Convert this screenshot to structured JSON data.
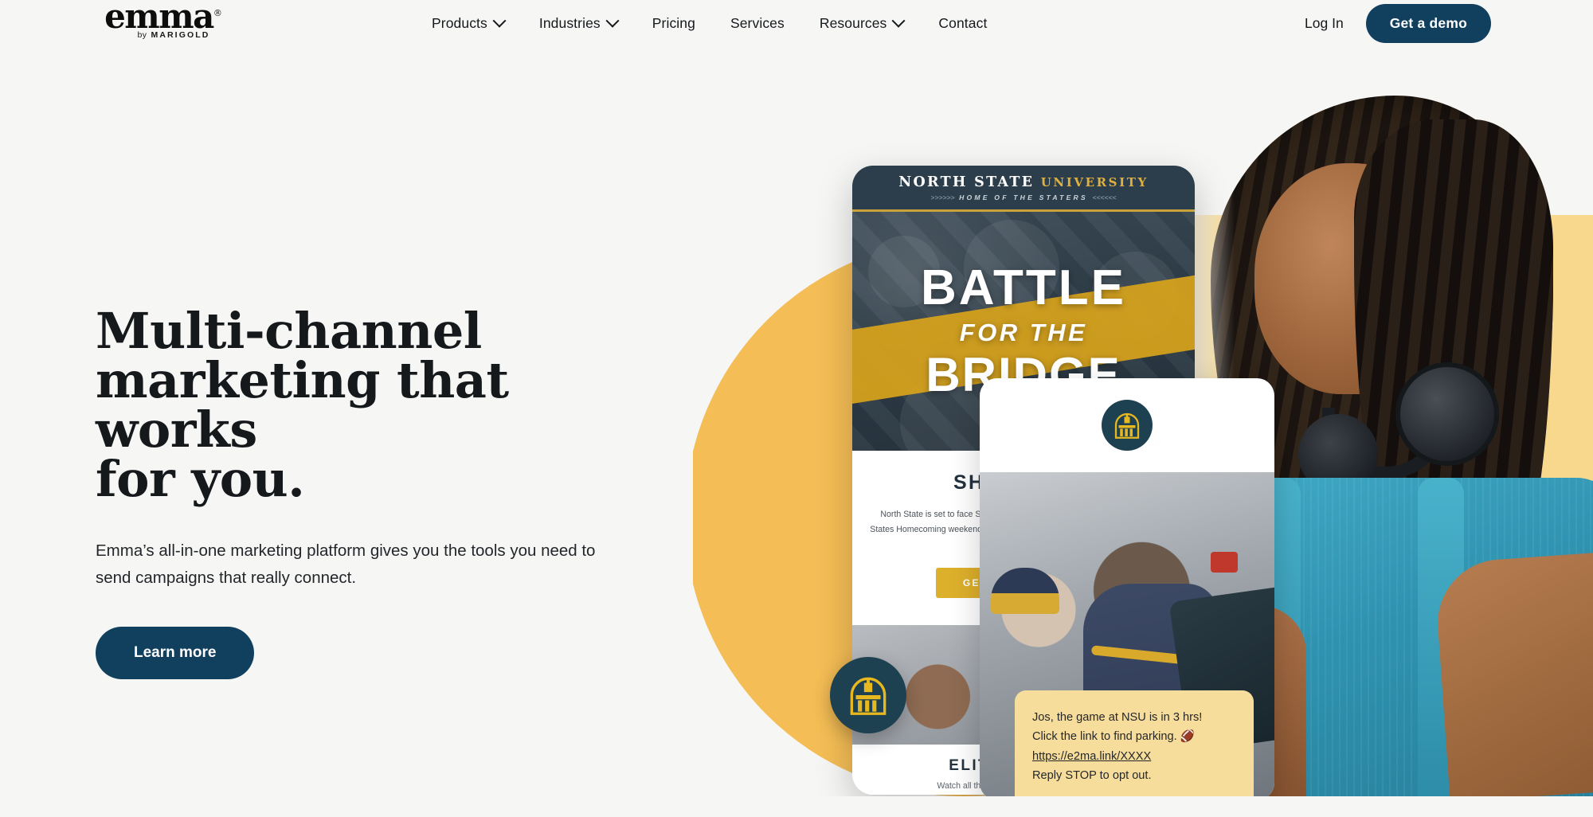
{
  "brand": {
    "logo_name": "emma",
    "logo_registered": "®",
    "logo_by": "by",
    "logo_parent": "MARIGOLD"
  },
  "nav": {
    "items": [
      {
        "label": "Products",
        "has_chevron": true
      },
      {
        "label": "Industries",
        "has_chevron": true
      },
      {
        "label": "Pricing",
        "has_chevron": false
      },
      {
        "label": "Services",
        "has_chevron": false
      },
      {
        "label": "Resources",
        "has_chevron": true
      },
      {
        "label": "Contact",
        "has_chevron": false
      }
    ],
    "login_label": "Log In",
    "demo_label": "Get a demo"
  },
  "hero": {
    "title_line1": "Multi-channel",
    "title_line2": "marketing that works",
    "title_line3": "for you.",
    "subtitle": "Emma’s all-in-one marketing platform gives you the tools you need to send campaigns that really connect.",
    "cta_label": "Learn more"
  },
  "email_mockup": {
    "masthead_main": "NORTH STATE ",
    "masthead_gold": "UNIVERSITY",
    "masthead_arrows_left": ">>>>>>",
    "masthead_tagline": "HOME OF THE STATERS",
    "masthead_arrows_right": "<<<<<<",
    "hero_line1": "BATTLE",
    "hero_line2": "FOR THE",
    "hero_line3": "BRIDGE",
    "section_title": "SHOWDOWN",
    "section_body": "North State is set to face South College in a fierce rivalry matchup during the States Homecoming weekend this season. The last five meetings, North State has won three of them.",
    "section_cta": "GET YOUR TICKETS",
    "footer_title": "ELITE MOMENTS",
    "footer_body": "Watch all the top plays from last week’s game."
  },
  "sms_mockup": {
    "badge_icon": "university-building-icon",
    "message_line1": "Jos, the game at NSU is in 3 hrs!",
    "message_line2": "Click the link to find parking. 🏈",
    "message_link": "https://e2ma.link/XXXX",
    "message_line4": "Reply STOP to opt out."
  },
  "colors": {
    "page_background": "#f6f6f5",
    "navy": "#11405f",
    "orange_circle": "#f4bd55",
    "pale_yellow": "#f8d88c",
    "email_navy": "#2c3e4b",
    "gold": "#d7a31c",
    "sms_bubble": "#f7dd9c"
  }
}
